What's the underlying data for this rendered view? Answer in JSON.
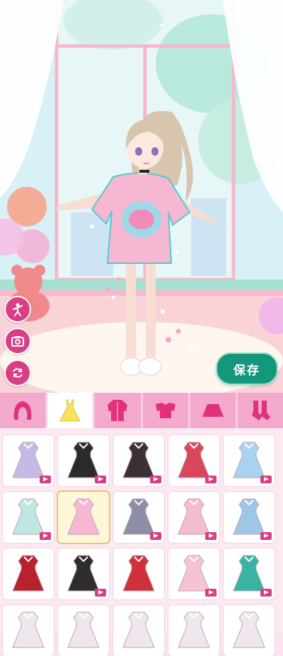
{
  "game": {
    "save_label": "保存",
    "colors": {
      "accent": "#d83f86",
      "save": "#15977b",
      "tab": "#f2a9cc"
    }
  },
  "side_buttons": [
    {
      "name": "pose-button",
      "icon": "figure-pose-icon"
    },
    {
      "name": "camera-button",
      "icon": "camera-icon"
    },
    {
      "name": "reset-button",
      "icon": "refresh-icon"
    }
  ],
  "category_tabs": [
    {
      "name": "tab-hair",
      "icon": "hair-icon",
      "selected": false
    },
    {
      "name": "tab-dress",
      "icon": "dress-icon",
      "selected": true
    },
    {
      "name": "tab-coat",
      "icon": "coat-icon",
      "selected": false
    },
    {
      "name": "tab-top",
      "icon": "top-icon",
      "selected": false
    },
    {
      "name": "tab-skirt",
      "icon": "skirt-icon",
      "selected": false
    },
    {
      "name": "tab-socks",
      "icon": "socks-icon",
      "selected": false
    }
  ],
  "clothing_items": [
    {
      "name": "lavender-frill-dress",
      "color": "#c7b9e6",
      "video": true,
      "selected": false
    },
    {
      "name": "black-maid-dress",
      "color": "#2b2b2b",
      "video": true,
      "selected": false
    },
    {
      "name": "gothic-lolita-dress",
      "color": "#3a3036",
      "video": true,
      "selected": false
    },
    {
      "name": "red-bow-dress",
      "color": "#d9475a",
      "video": true,
      "selected": false
    },
    {
      "name": "blue-lolita-dress",
      "color": "#a9d1f0",
      "video": true,
      "selected": false
    },
    {
      "name": "pastel-hoodie-dress",
      "color": "#bfe6e3",
      "video": true,
      "selected": false
    },
    {
      "name": "pink-tshirt-dress",
      "color": "#f6b7d2",
      "video": false,
      "selected": true
    },
    {
      "name": "grey-frill-gown",
      "color": "#8d8ea6",
      "video": true,
      "selected": false
    },
    {
      "name": "pink-apron-dress",
      "color": "#f5bcd0",
      "video": true,
      "selected": false
    },
    {
      "name": "blue-white-dress",
      "color": "#9fc6e6",
      "video": true,
      "selected": false
    },
    {
      "name": "red-cheongsam",
      "color": "#b7222e",
      "video": false,
      "selected": false
    },
    {
      "name": "black-goth-dress",
      "color": "#2d2d2d",
      "video": true,
      "selected": false
    },
    {
      "name": "red-collar-dress",
      "color": "#d0303a",
      "video": false,
      "selected": false
    },
    {
      "name": "white-pink-dress",
      "color": "#f6c3d6",
      "video": true,
      "selected": false
    },
    {
      "name": "teal-idol-outfit",
      "color": "#3bb3a4",
      "video": true,
      "selected": false
    },
    {
      "name": "partial-item-1",
      "color": "#efe6ee",
      "video": false,
      "selected": false
    },
    {
      "name": "partial-item-2",
      "color": "#efe6ee",
      "video": false,
      "selected": false
    },
    {
      "name": "partial-item-3",
      "color": "#efe6ee",
      "video": false,
      "selected": false
    },
    {
      "name": "partial-item-4",
      "color": "#efe6ee",
      "video": false,
      "selected": false
    },
    {
      "name": "partial-item-5",
      "color": "#efe6ee",
      "video": false,
      "selected": false
    }
  ]
}
